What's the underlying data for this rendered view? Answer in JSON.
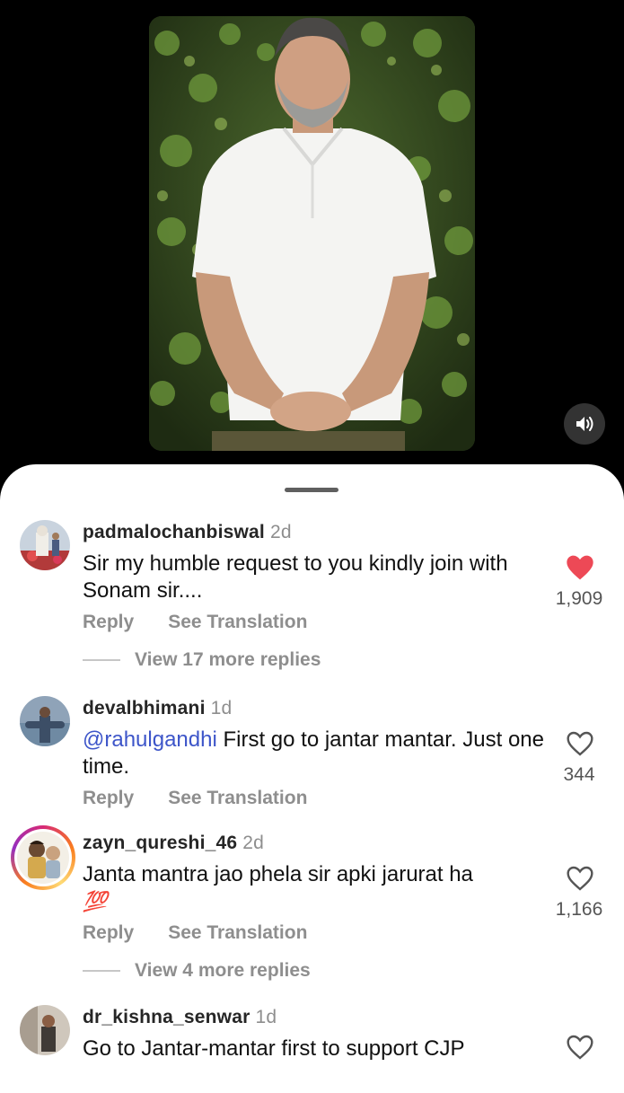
{
  "video": {
    "mute_icon": "speaker-icon"
  },
  "colors": {
    "like_red": "#ed4956",
    "mention_blue": "#3d55c9",
    "secondary_grey": "#8e8e8e"
  },
  "comments": [
    {
      "username": "padmalochanbiswal",
      "time": "2d",
      "text": "Sir my humble request to you kindly join with Sonam sir....",
      "likes": "1,909",
      "liked": true,
      "reply_label": "Reply",
      "translate_label": "See Translation",
      "view_replies": "View 17 more replies"
    },
    {
      "username": "devalbhimani",
      "time": "1d",
      "mention": "@rahulgandhi",
      "text": " First go to jantar mantar. Just one time.",
      "likes": "344",
      "liked": false,
      "reply_label": "Reply",
      "translate_label": "See Translation"
    },
    {
      "username": "zayn_qureshi_46",
      "time": "2d",
      "text": "Janta mantra jao phela sir apki jarurat ha",
      "emoji": "💯",
      "likes": "1,166",
      "liked": false,
      "reply_label": "Reply",
      "translate_label": "See Translation",
      "view_replies": "View 4 more replies"
    },
    {
      "username": "dr_kishna_senwar",
      "time": "1d",
      "text": "Go to Jantar-mantar first to support CJP",
      "liked": false
    }
  ]
}
